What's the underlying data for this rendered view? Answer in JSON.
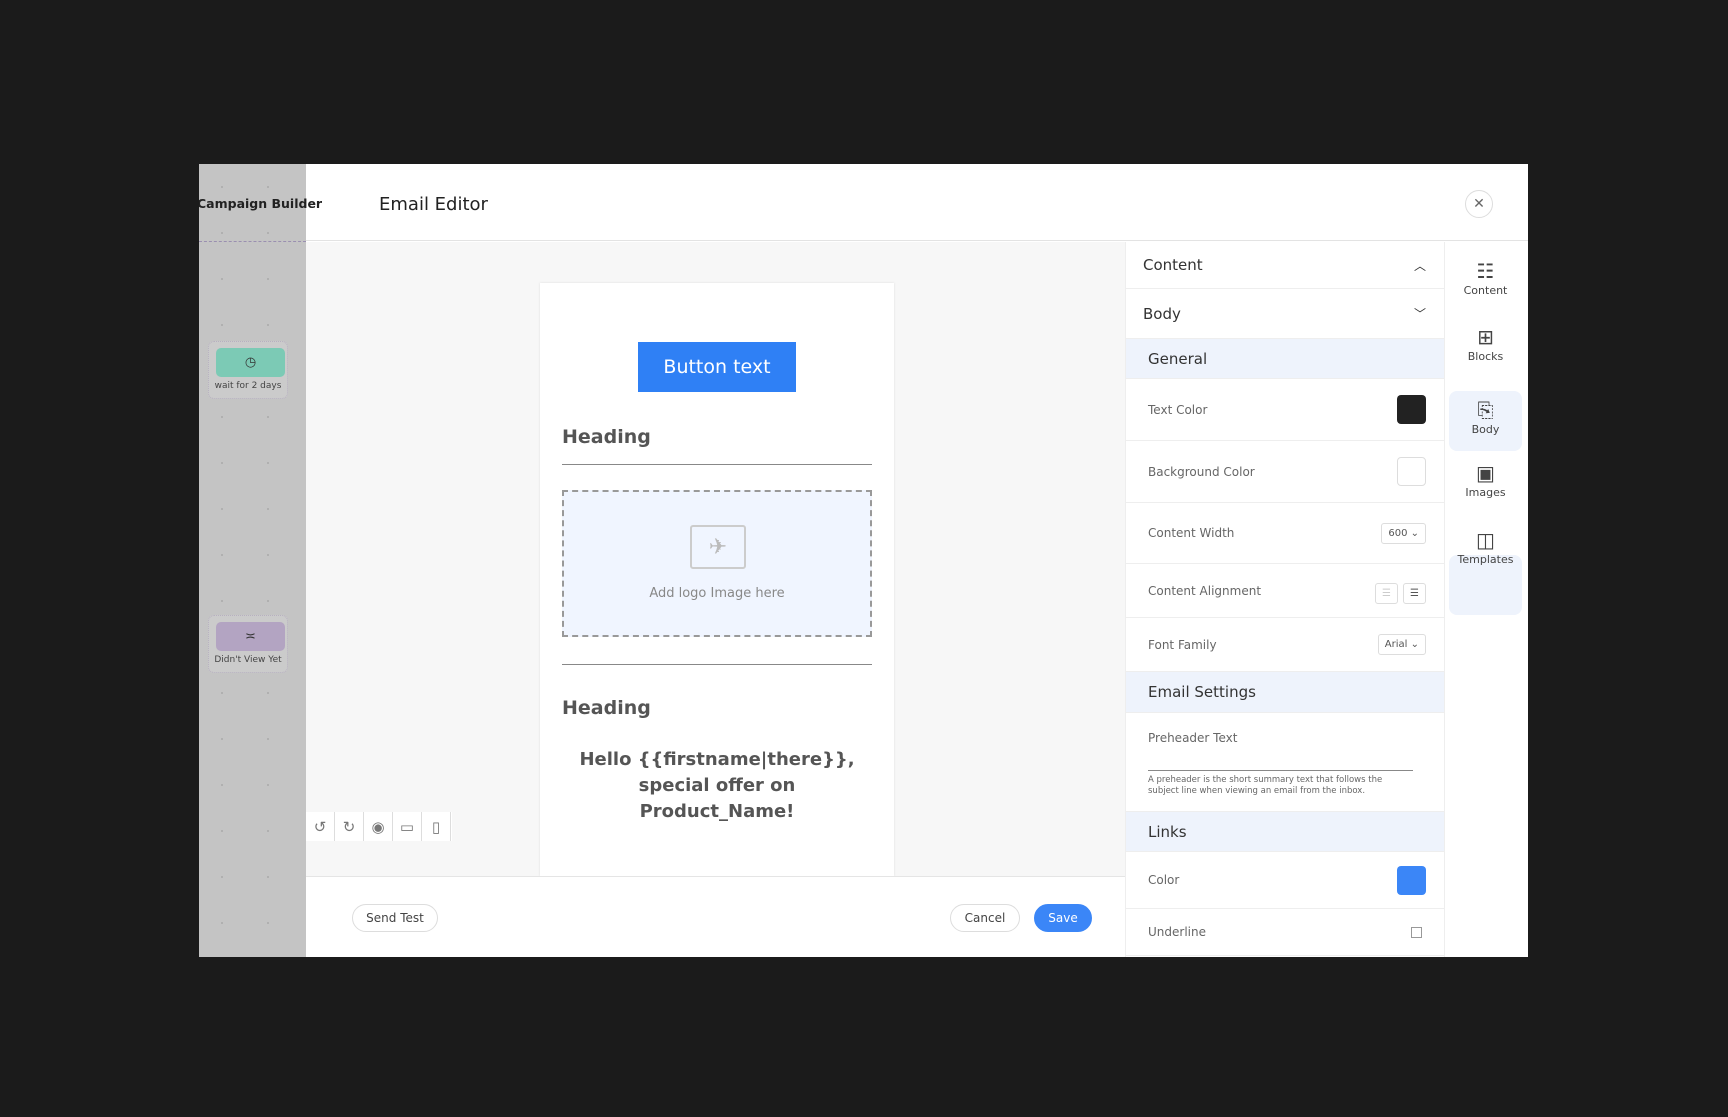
{
  "background_page": {
    "title": "Campaign Builder",
    "nodes": [
      {
        "label": "wait for 2 days",
        "icon": "clock-icon",
        "color": "#7ccab5"
      },
      {
        "label": "Didn't View Yet",
        "icon": "closed-eye-icon",
        "color": "#b3a4c2"
      }
    ]
  },
  "header": {
    "title": "Email Editor",
    "close_icon": "close-icon"
  },
  "email": {
    "button_text": "Button text",
    "heading_1": "Heading",
    "logo_placeholder": "Add logo Image here",
    "heading_2": "Heading",
    "body_text": "Hello {{firstname|there}}, special offer on Product_Name!"
  },
  "toolbar": [
    "undo-icon",
    "redo-icon",
    "eye-icon",
    "desktop-icon",
    "mobile-icon"
  ],
  "footer": {
    "send_test": "Send Test",
    "cancel": "Cancel",
    "save": "Save"
  },
  "panel": {
    "content_label": "Content",
    "body_label": "Body",
    "general": {
      "title": "General",
      "text_color_label": "Text Color",
      "text_color": "#222222",
      "bg_color_label": "Background Color",
      "bg_color": "#ffffff",
      "width_label": "Content Width",
      "width_value": "600",
      "alignment_label": "Content Alignment",
      "font_label": "Font Family",
      "font_value": "Arial"
    },
    "email_settings": {
      "title": "Email Settings",
      "preheader_label": "Preheader Text",
      "preheader_value": "",
      "preheader_help": "A preheader is the short summary text that follows the subject line when viewing an email from the inbox."
    },
    "links": {
      "title": "Links",
      "color_label": "Color",
      "color": "#3b86f7",
      "underline_label": "Underline",
      "underline": false
    }
  },
  "rail": [
    {
      "label": "Content",
      "icon": "content-icon"
    },
    {
      "label": "Blocks",
      "icon": "blocks-icon"
    },
    {
      "label": "Body",
      "icon": "body-icon",
      "active": true
    },
    {
      "label": "Images",
      "icon": "images-icon"
    },
    {
      "label": "Templates",
      "icon": "templates-icon"
    }
  ],
  "colors": {
    "accent": "#2f80f5",
    "section_bg": "#eef3fc"
  }
}
